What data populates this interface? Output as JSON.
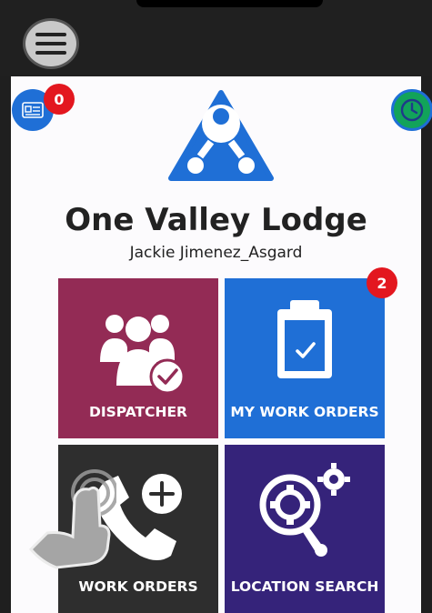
{
  "header": {
    "menu_icon": "hamburger-menu-icon",
    "card_icon": "id-card-icon",
    "card_badge": "0",
    "clock_icon": "clock-icon"
  },
  "brand": {
    "logo_icon": "triangle-nodes-logo",
    "title": "One Valley Lodge",
    "user": "Jackie Jimenez_Asgard"
  },
  "tiles": [
    {
      "label": "DISPATCHER",
      "icon": "group-check-icon",
      "color": "#932b55"
    },
    {
      "label": "MY WORK ORDERS",
      "icon": "clipboard-check-icon",
      "color": "#1f6fd6",
      "badge": "2"
    },
    {
      "label": "WORK ORDERS",
      "icon": "phone-plus-icon",
      "color": "#2e2e2e"
    },
    {
      "label": "LOCATION SEARCH",
      "icon": "gear-search-icon",
      "color": "#35237a"
    }
  ],
  "overlay": {
    "icon": "tap-hand-icon"
  },
  "colors": {
    "accent_blue": "#1f6fd6",
    "badge_red": "#e3171f",
    "clock_green": "#12a35a"
  }
}
